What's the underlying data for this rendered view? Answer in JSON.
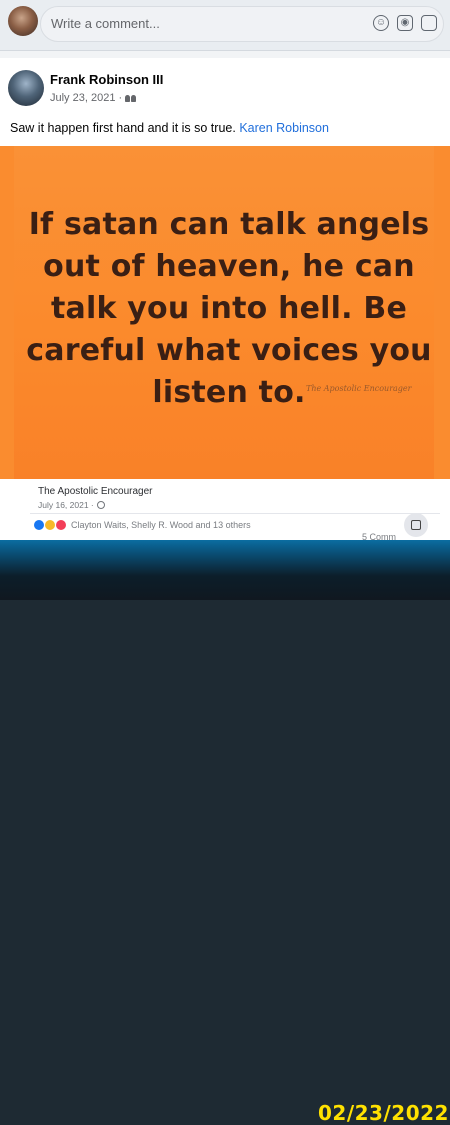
{
  "comment_bar": {
    "placeholder": "Write a comment...",
    "icons": [
      "emoji-icon",
      "camera-icon",
      "gif-icon"
    ]
  },
  "post": {
    "author": "Frank Robinson III",
    "date": "July 23, 2021 ·",
    "audience_icon": "friends-icon",
    "text": "Saw it happen first hand and it is so true.",
    "mention": "Karen Robinson",
    "image": {
      "quote": "If satan can talk angels out of heaven, he can talk you into hell. Be careful what voices you listen to.",
      "watermark": "The Apostolic Encourager",
      "background": "#fa8c2f",
      "text_color": "#3a1f14"
    },
    "shared_source": {
      "name": "The Apostolic Encourager",
      "date": "July 16, 2021 ·"
    },
    "reactions": {
      "types": [
        "like",
        "care",
        "love"
      ],
      "names": "Clayton Waits, Shelly R. Wood and 13 others",
      "comments": "5 Comm"
    }
  },
  "datestamp": "02/23/2022"
}
